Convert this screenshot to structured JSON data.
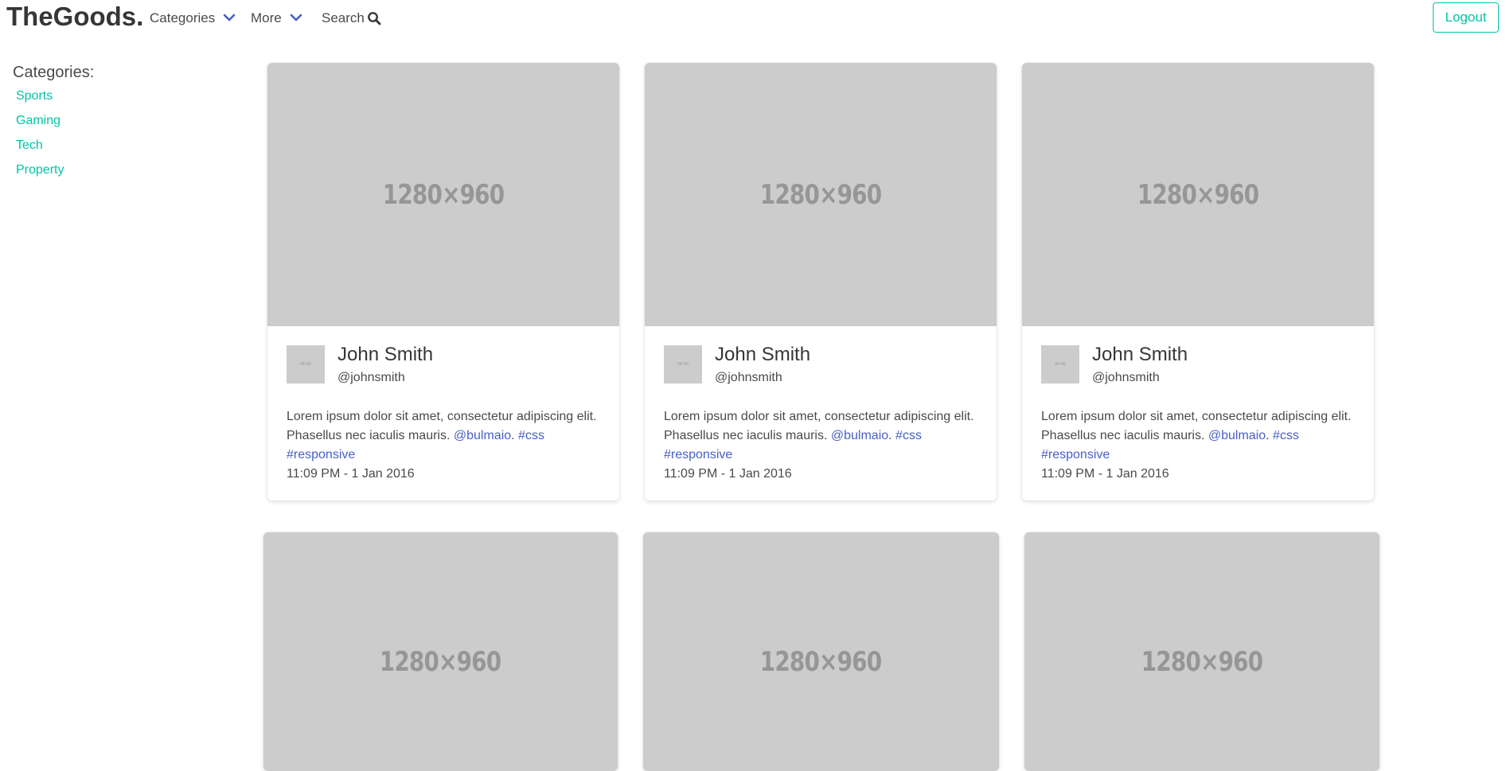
{
  "navbar": {
    "brand": "TheGoods.",
    "categories_label": "Categories",
    "more_label": "More",
    "search_label": "Search",
    "logout_label": "Logout",
    "accent_color": "#00c4a7",
    "chevron_color": "#485fc7"
  },
  "sidebar": {
    "title": "Categories:",
    "items": [
      {
        "label": "Sports"
      },
      {
        "label": "Gaming"
      },
      {
        "label": "Tech"
      },
      {
        "label": "Property"
      }
    ]
  },
  "cards": [
    {
      "image_text": "1280×960",
      "avatar_text": "96×96",
      "name": "John Smith",
      "handle": "@johnsmith",
      "text": "Lorem ipsum dolor sit amet, consectetur adipiscing elit. Phasellus nec iaculis mauris.",
      "mention": "@bulmaio",
      "tag1": "#css",
      "tag2": "#responsive",
      "timestamp": "11:09 PM - 1 Jan 2016"
    },
    {
      "image_text": "1280×960",
      "avatar_text": "96×96",
      "name": "John Smith",
      "handle": "@johnsmith",
      "text": "Lorem ipsum dolor sit amet, consectetur adipiscing elit. Phasellus nec iaculis mauris.",
      "mention": "@bulmaio",
      "tag1": "#css",
      "tag2": "#responsive",
      "timestamp": "11:09 PM - 1 Jan 2016"
    },
    {
      "image_text": "1280×960",
      "avatar_text": "96×96",
      "name": "John Smith",
      "handle": "@johnsmith",
      "text": "Lorem ipsum dolor sit amet, consectetur adipiscing elit. Phasellus nec iaculis mauris.",
      "mention": "@bulmaio",
      "tag1": "#css",
      "tag2": "#responsive",
      "timestamp": "11:09 PM - 1 Jan 2016"
    },
    {
      "image_text": "1280×960"
    },
    {
      "image_text": "1280×960"
    },
    {
      "image_text": "1280×960"
    }
  ]
}
